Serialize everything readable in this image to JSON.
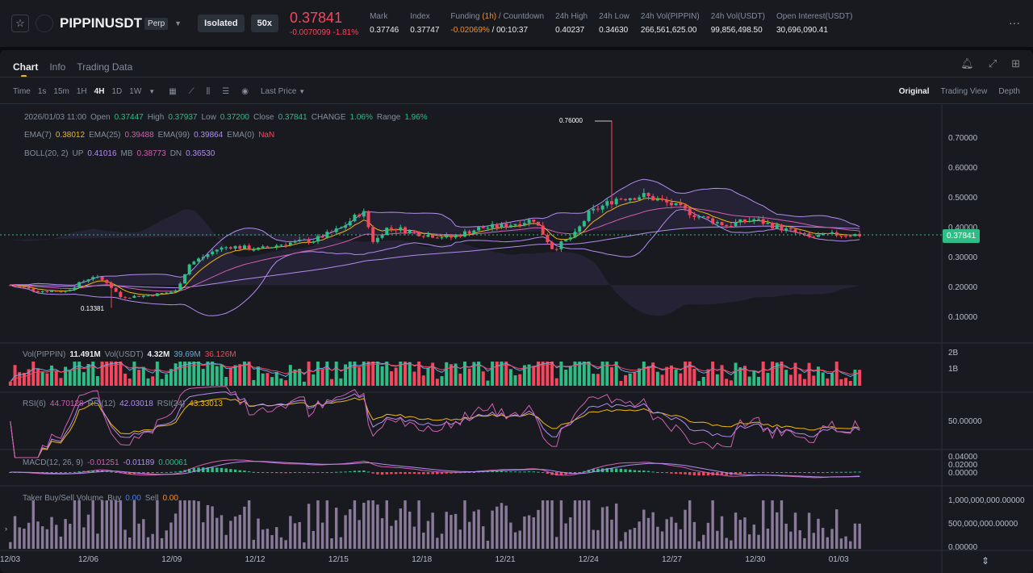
{
  "header": {
    "symbol": "PIPPINUSDT",
    "contract": "Perp",
    "margin_mode": "Isolated",
    "leverage": "50x",
    "last_price": "0.37841",
    "change": "-0.0070099",
    "change_pct": "-1.81%",
    "stats": [
      {
        "label": "Mark",
        "value": "0.37746"
      },
      {
        "label": "Index",
        "value": "0.37747"
      },
      {
        "label": "24h High",
        "value": "0.40237"
      },
      {
        "label": "24h Low",
        "value": "0.34630"
      },
      {
        "label": "24h Vol(PIPPIN)",
        "value": "266,561,625.00"
      },
      {
        "label": "24h Vol(USDT)",
        "value": "99,856,498.50"
      },
      {
        "label": "Open Interest(USDT)",
        "value": "30,696,090.41"
      }
    ],
    "funding_label": "Funding",
    "funding_period": "(1h)",
    "countdown_label": "/ Countdown",
    "funding_rate": "-0.02069%",
    "countdown": "/ 00:10:37",
    "more": "···"
  },
  "tabs": [
    "Chart",
    "Info",
    "Trading Data"
  ],
  "toolbar": {
    "intervals": [
      "Time",
      "1s",
      "15m",
      "1H",
      "4H",
      "1D",
      "1W"
    ],
    "active": "4H",
    "price_type": "Last Price",
    "views": [
      "Original",
      "Trading View",
      "Depth"
    ]
  },
  "ohlc": {
    "date": "2026/01/03 11:00",
    "open_l": "Open",
    "open": "0.37447",
    "high_l": "High",
    "high": "0.37937",
    "low_l": "Low",
    "low": "0.37200",
    "close_l": "Close",
    "close": "0.37841",
    "change_l": "CHANGE",
    "change": "1.06%",
    "range_l": "Range",
    "range": "1.96%"
  },
  "ema": {
    "l7": "EMA(7)",
    "v7": "0.38012",
    "l25": "EMA(25)",
    "v25": "0.39488",
    "l99": "EMA(99)",
    "v99": "0.39864",
    "l0": "EMA(0)",
    "v0": "NaN"
  },
  "boll": {
    "label": "BOLL(20, 2)",
    "up_l": "UP",
    "up": "0.41016",
    "mb_l": "MB",
    "mb": "0.38773",
    "dn_l": "DN",
    "dn": "0.36530"
  },
  "vol": {
    "l1": "Vol(PIPPIN)",
    "v1": "11.491M",
    "l2": "Vol(USDT)",
    "v2": "4.32M",
    "v3": "39.69M",
    "v4": "36.126M"
  },
  "rsi": {
    "l6": "RSI(6)",
    "v6": "44.70128",
    "l12": "RSI(12)",
    "v12": "42.03018",
    "l24": "RSI(24)",
    "v24": "43.33013"
  },
  "macd": {
    "label": "MACD(12, 26, 9)",
    "dif": "-0.01251",
    "dea": "-0.01189",
    "hist": "0.00061"
  },
  "taker": {
    "label": "Taker Buy/Sell Volume",
    "buy_l": "Buy",
    "buy": "0.00",
    "sell_l": "Sell",
    "sell": "0.00"
  },
  "axes": {
    "price": [
      "0.70000",
      "0.60000",
      "0.50000",
      "0.40000",
      "0.30000",
      "0.20000",
      "0.10000"
    ],
    "vol": [
      "2B",
      "1B"
    ],
    "rsi": [
      "50.00000"
    ],
    "macd": [
      "0.04000",
      "0.02000",
      "0.00000"
    ],
    "taker": [
      "1,000,000,000.00000",
      "500,000,000.00000",
      "0.00000"
    ],
    "dates": [
      "12/03",
      "12/06",
      "12/09",
      "12/12",
      "12/15",
      "12/18",
      "12/21",
      "12/24",
      "12/27",
      "12/30",
      "01/03"
    ]
  },
  "annotations": {
    "high": "0.76000",
    "low": "0.13381"
  },
  "current_price_tag": "0.37841",
  "chart_data": {
    "type": "candlestick",
    "interval": "4H",
    "ylim": [
      0.05,
      0.75
    ],
    "price_path_day_offsets": [
      0,
      1,
      2,
      3,
      3.5,
      4,
      5,
      6,
      6.5,
      7.5,
      8,
      9,
      10,
      11,
      12,
      12.8,
      13.2,
      13.6,
      14,
      15,
      16,
      17,
      18,
      19,
      19.7,
      20.5,
      21,
      22,
      23,
      24,
      25,
      26,
      27,
      28,
      29,
      30,
      31
    ],
    "price_path_close": [
      0.21,
      0.19,
      0.19,
      0.24,
      0.22,
      0.17,
      0.175,
      0.19,
      0.28,
      0.33,
      0.34,
      0.33,
      0.35,
      0.36,
      0.4,
      0.46,
      0.35,
      0.4,
      0.4,
      0.38,
      0.37,
      0.4,
      0.41,
      0.43,
      0.33,
      0.38,
      0.45,
      0.5,
      0.51,
      0.48,
      0.44,
      0.41,
      0.43,
      0.4,
      0.37,
      0.38,
      0.378
    ],
    "max_high": 0.76,
    "min_low": 0.13381
  },
  "colors": {
    "up": "#2ebd85",
    "down": "#f6465d",
    "ema7": "#f0b90b",
    "ema25": "#d05fb0",
    "ema99": "#b28cf0",
    "boll": "#b28cf0"
  }
}
